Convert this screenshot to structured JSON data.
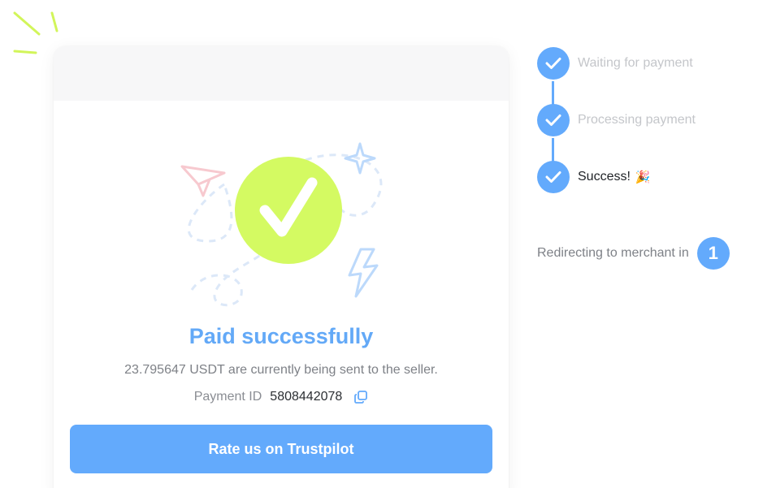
{
  "payment": {
    "title": "Paid successfully",
    "message": "23.795647 USDT are currently being sent to the seller.",
    "id_label": "Payment ID",
    "id_value": "5808442078"
  },
  "actions": {
    "trustpilot_label": "Rate us on Trustpilot"
  },
  "steps": [
    {
      "label": "Waiting for payment",
      "status": "done"
    },
    {
      "label": "Processing payment",
      "status": "done"
    },
    {
      "label": "Success!",
      "status": "current",
      "emoji": "🎉"
    }
  ],
  "redirect": {
    "text": "Redirecting to merchant in",
    "countdown": "1"
  },
  "colors": {
    "accent": "#63aafc",
    "success_circle": "#d4fa62",
    "title": "#63a9f7"
  }
}
